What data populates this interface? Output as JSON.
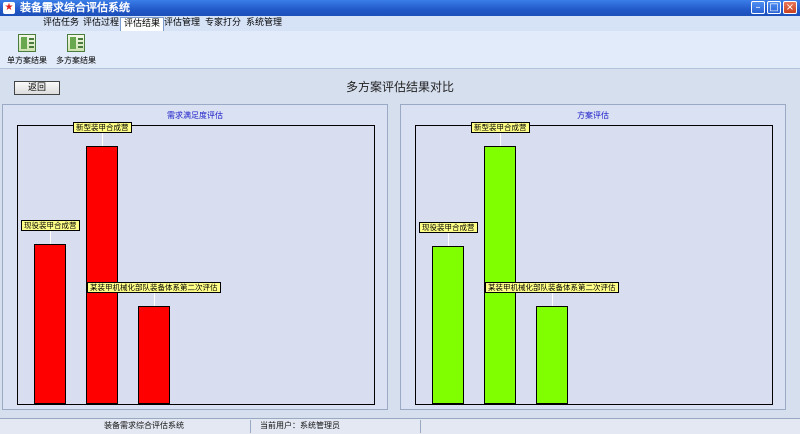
{
  "window": {
    "title": "装备需求综合评估系统",
    "app_icon": "app-icon"
  },
  "menu": [
    {
      "label": "评估任务",
      "active": false
    },
    {
      "label": "评估过程",
      "active": false
    },
    {
      "label": "评估结果",
      "active": true
    },
    {
      "label": "评估管理",
      "active": false
    },
    {
      "label": "专家打分",
      "active": false
    },
    {
      "label": "系统管理",
      "active": false
    }
  ],
  "ribbon": [
    {
      "label": "单方案结果",
      "icon": "report-icon"
    },
    {
      "label": "多方案结果",
      "icon": "report-icon"
    }
  ],
  "toolbar": {
    "back_label": "返回"
  },
  "page_title": "多方案评估结果对比",
  "chart_data": [
    {
      "type": "bar",
      "title": "需求满足度评估",
      "categories": [
        "现役装甲合成营",
        "新型装甲合成营",
        "某装甲机械化部队装备体系第二次评估"
      ],
      "values": [
        0.59,
        0.95,
        0.36
      ],
      "ylim": [
        0,
        1
      ],
      "color": "#ff0000",
      "grid": false,
      "data_labels": true
    },
    {
      "type": "bar",
      "title": "方案评估",
      "categories": [
        "现役装甲合成营",
        "新型装甲合成营",
        "某装甲机械化部队装备体系第二次评估"
      ],
      "values": [
        0.58,
        0.95,
        0.36
      ],
      "ylim": [
        0,
        1
      ],
      "color": "#80ff00",
      "grid": false,
      "data_labels": true
    }
  ],
  "status": {
    "system_name": "装备需求综合评估系统",
    "current_user": "当前用户：系统管理员"
  }
}
